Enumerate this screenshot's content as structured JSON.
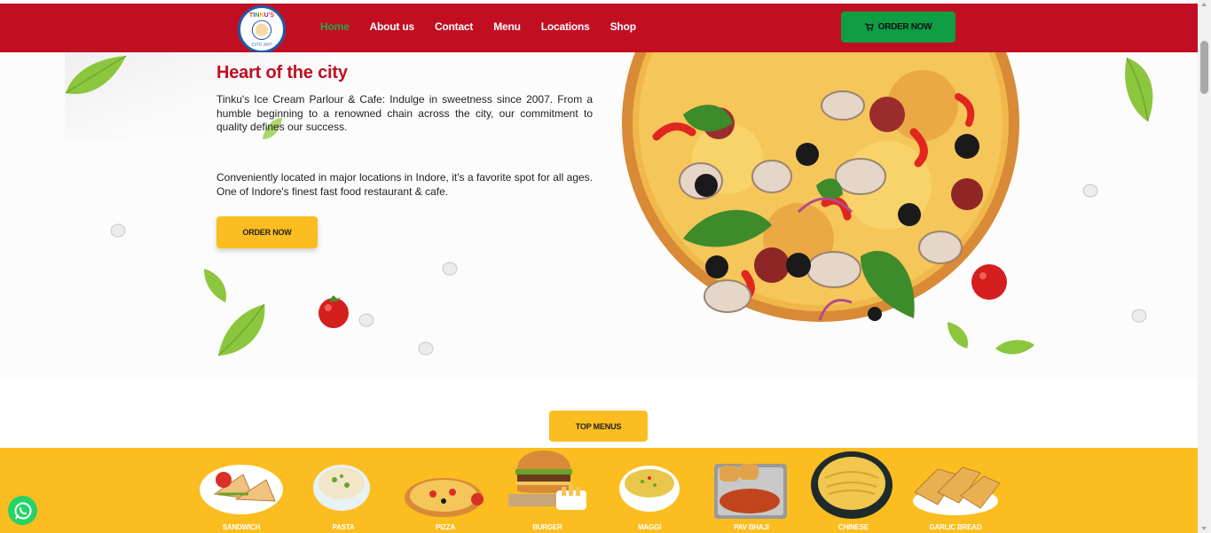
{
  "header": {
    "logo_text": "TINKU'S",
    "logo_sub": "ESTD 2007",
    "nav": [
      {
        "label": "Home",
        "active": true
      },
      {
        "label": "About us",
        "active": false
      },
      {
        "label": "Contact",
        "active": false
      },
      {
        "label": "Menu",
        "active": false
      },
      {
        "label": "Locations",
        "active": false
      },
      {
        "label": "Shop",
        "active": false
      }
    ],
    "order_label": "ORDER NOW"
  },
  "hero": {
    "title": "Heart of the city",
    "paragraph1": "Tinku's Ice Cream Parlour & Cafe: Indulge in sweetness since 2007. From a humble beginning to a renowned chain across the city, our commitment to quality defines our success.",
    "paragraph2": "Conveniently located in major locations in Indore, it's a favorite spot for all ages. One of Indore's finest fast food restaurant & cafe.",
    "order_label": "ORDER NOW"
  },
  "top_menus_label": "TOP MENUS",
  "menu_items": [
    {
      "label": "SANDWICH",
      "icon": "sandwich-icon"
    },
    {
      "label": "PASTA",
      "icon": "pasta-icon"
    },
    {
      "label": "PIZZA",
      "icon": "pizza-icon"
    },
    {
      "label": "BURGER",
      "icon": "burger-icon"
    },
    {
      "label": "MAGGI",
      "icon": "maggi-icon"
    },
    {
      "label": "PAV BHAJI",
      "icon": "pav-bhaji-icon"
    },
    {
      "label": "CHINESE",
      "icon": "chinese-icon"
    },
    {
      "label": "GARLIC BREAD",
      "icon": "garlic-bread-icon"
    }
  ],
  "colors": {
    "header_red": "#c20e22",
    "order_green": "#0f9d45",
    "accent_yellow": "#fbbd1f",
    "active_nav_green": "#23a84a",
    "whatsapp_green": "#25d366"
  },
  "icons": [
    "cart-icon",
    "whatsapp-icon"
  ]
}
